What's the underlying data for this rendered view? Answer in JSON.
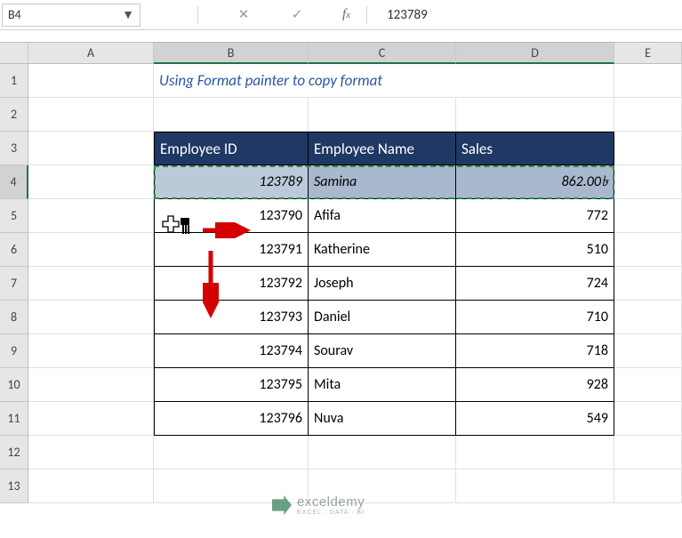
{
  "namebox": {
    "ref": "B4"
  },
  "formula": {
    "value": "123789"
  },
  "columns": [
    "",
    "A",
    "B",
    "C",
    "D",
    "E"
  ],
  "rows": [
    "1",
    "2",
    "3",
    "4",
    "5",
    "6",
    "7",
    "8",
    "9",
    "10",
    "11",
    "12",
    "13"
  ],
  "title": "Using Format painter to copy format",
  "headers": {
    "b": "Employee ID",
    "c": "Employee Name",
    "d": "Sales"
  },
  "selected_row": {
    "id": "123789",
    "name": "Samina",
    "sales": "862.00৳"
  },
  "data_rows": [
    {
      "id": "123790",
      "name": "Afifa",
      "sales": "772"
    },
    {
      "id": "123791",
      "name": "Katherine",
      "sales": "510"
    },
    {
      "id": "123792",
      "name": "Joseph",
      "sales": "724"
    },
    {
      "id": "123793",
      "name": "Daniel",
      "sales": "710"
    },
    {
      "id": "123794",
      "name": "Sourav",
      "sales": "718"
    },
    {
      "id": "123795",
      "name": "Mita",
      "sales": "928"
    },
    {
      "id": "123796",
      "name": "Nuva",
      "sales": "549"
    }
  ],
  "watermark": {
    "main": "exceldemy",
    "sub": "EXCEL · DATA · BI"
  },
  "chart_data": {
    "type": "table",
    "title": "Using Format painter to copy format",
    "columns": [
      "Employee ID",
      "Employee Name",
      "Sales"
    ],
    "rows": [
      [
        "123789",
        "Samina",
        862.0
      ],
      [
        "123790",
        "Afifa",
        772
      ],
      [
        "123791",
        "Katherine",
        510
      ],
      [
        "123792",
        "Joseph",
        724
      ],
      [
        "123793",
        "Daniel",
        710
      ],
      [
        "123794",
        "Sourav",
        718
      ],
      [
        "123795",
        "Mita",
        928
      ],
      [
        "123796",
        "Nuva",
        549
      ]
    ]
  }
}
